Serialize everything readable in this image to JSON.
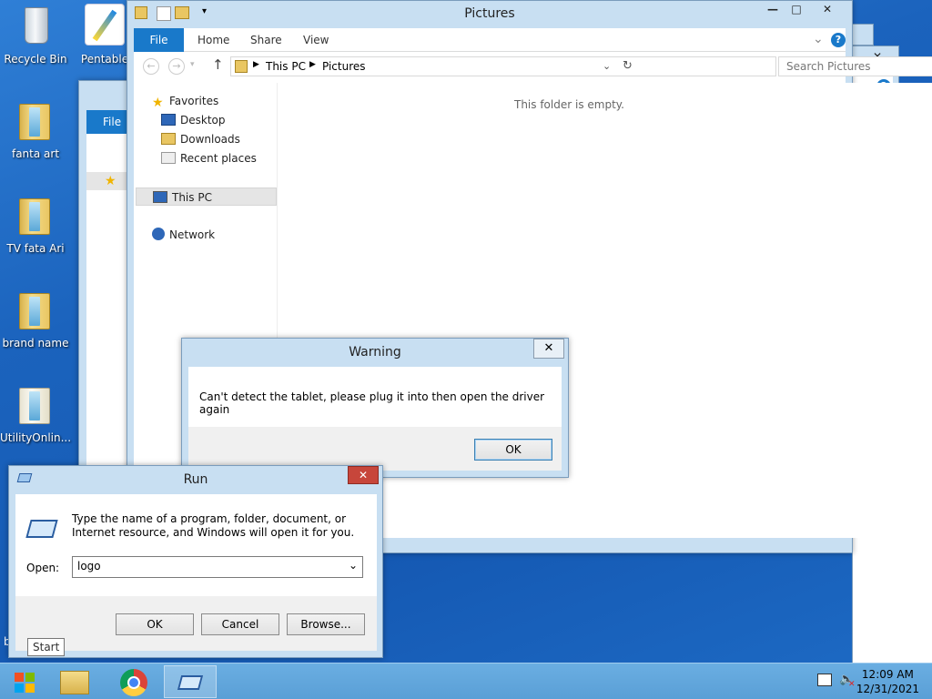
{
  "desktop": {
    "icons": [
      {
        "label": "Recycle Bin"
      },
      {
        "label": "Pentable"
      },
      {
        "label": "fanta art"
      },
      {
        "label": "TV  fata Ari"
      },
      {
        "label": "brand name"
      },
      {
        "label": "UtilityOnlin..."
      }
    ]
  },
  "explorer": {
    "title": "Pictures",
    "tabs": {
      "file": "File",
      "home": "Home",
      "share": "Share",
      "view": "View"
    },
    "breadcrumb": [
      "This PC",
      "Pictures"
    ],
    "search_placeholder": "Search Pictures",
    "nav": {
      "favorites": "Favorites",
      "desktop": "Desktop",
      "downloads": "Downloads",
      "recent": "Recent places",
      "this_pc": "This PC",
      "network": "Network"
    },
    "empty_message": "This folder is empty."
  },
  "background_window": {
    "file_tab": "File"
  },
  "warning_dialog": {
    "title": "Warning",
    "message": "Can't detect the tablet, please plug it into then open the driver again",
    "ok_label": "OK"
  },
  "run_dialog": {
    "title": "Run",
    "description": "Type the name of a program, folder, document, or Internet resource, and Windows will open it for you.",
    "open_label": "Open:",
    "open_value": "logo",
    "ok_label": "OK",
    "cancel_label": "Cancel",
    "browse_label": "Browse..."
  },
  "tooltip": {
    "text": "Start"
  },
  "taskbar": {
    "time": "12:09 AM",
    "date": "12/31/2021"
  },
  "colors": {
    "accent": "#1979ca",
    "close_red": "#c7463b",
    "taskbar": "#6aaee2"
  }
}
